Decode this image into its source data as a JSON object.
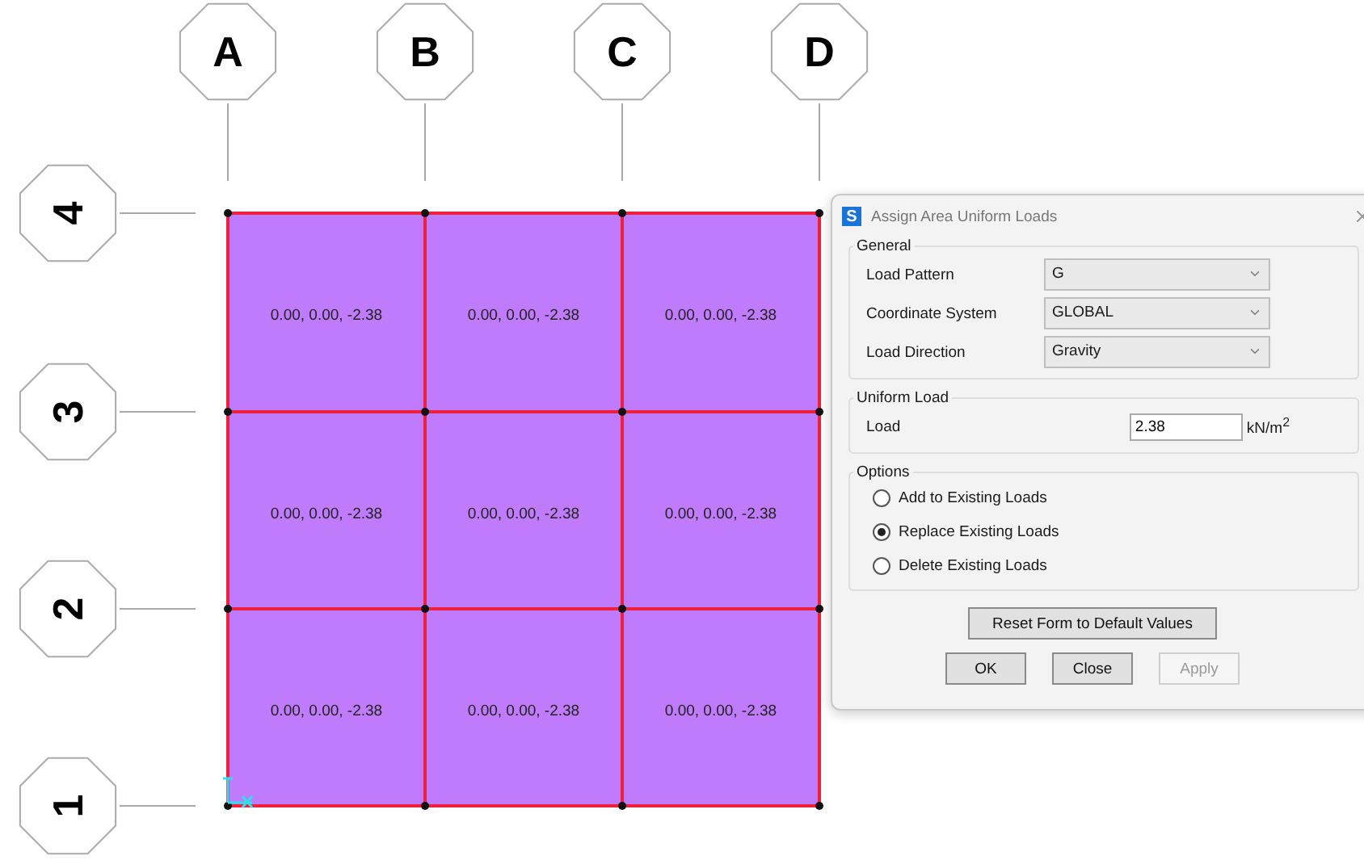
{
  "plan": {
    "columns": [
      "A",
      "B",
      "C",
      "D"
    ],
    "rows": [
      "4",
      "3",
      "2",
      "1"
    ],
    "cells": [
      [
        "0.00, 0.00, -2.38",
        "0.00, 0.00, -2.38",
        "0.00, 0.00, -2.38"
      ],
      [
        "0.00, 0.00, -2.38",
        "0.00, 0.00, -2.38",
        "0.00, 0.00, -2.38"
      ],
      [
        "0.00, 0.00, -2.38",
        "0.00, 0.00, -2.38",
        "0.00, 0.00, -2.38"
      ]
    ]
  },
  "dialog": {
    "title": "Assign Area Uniform Loads",
    "app_letter": "S",
    "general": {
      "title": "General",
      "fields": [
        {
          "label": "Load Pattern",
          "value": "G"
        },
        {
          "label": "Coordinate System",
          "value": "GLOBAL"
        },
        {
          "label": "Load Direction",
          "value": "Gravity"
        }
      ]
    },
    "uniform_load": {
      "title": "Uniform Load",
      "label": "Load",
      "value": "2.38",
      "unit": "kN/m$^{2}$"
    },
    "options": {
      "title": "Options",
      "items": [
        {
          "label": "Add to Existing Loads",
          "selected": false
        },
        {
          "label": "Replace Existing Loads",
          "selected": true
        },
        {
          "label": "Delete Existing Loads",
          "selected": false
        }
      ]
    },
    "reset_button": "Reset Form to Default Values",
    "buttons": [
      {
        "label": "OK",
        "disabled": false
      },
      {
        "label": "Close",
        "disabled": false
      },
      {
        "label": "Apply",
        "disabled": true
      }
    ]
  }
}
